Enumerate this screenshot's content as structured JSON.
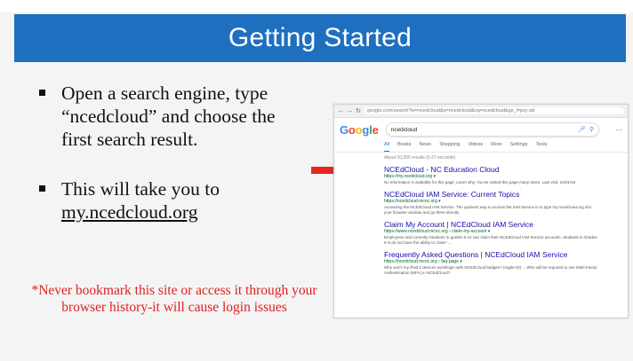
{
  "slide": {
    "title": "Getting Started",
    "bullets": [
      {
        "text": "Open a search engine, type “ncedcloud” and choose the first search result."
      },
      {
        "prefix": "This will take you to ",
        "link": "my.ncedcloud.org"
      }
    ],
    "warning": "*Never bookmark this site or access it through your browser history-it will cause login issues"
  },
  "colors": {
    "title_bar": "#1f6fc0",
    "warning": "#e02020",
    "arrow": "#e8251d"
  },
  "screenshot": {
    "url": "google.com/search?ei=ncedcloud&q=ncedcloud&oq=ncedcloud&gs_l=psy-ab",
    "logo": "Google",
    "query": "ncedcloud",
    "tabs": [
      "All",
      "Books",
      "News",
      "Shopping",
      "Videos",
      "More",
      "Settings",
      "Tools"
    ],
    "stats": "About 10,300 results (0.37 seconds)",
    "results": [
      {
        "title": "NCEdCloud - NC Education Cloud",
        "url": "https://my.ncedcloud.org ▾",
        "desc": "No information is available for this page. Learn why. You've visited this page many times. Last visit: 10/31/19"
      },
      {
        "title": "NCEdCloud IAM Service: Current Topics",
        "url": "https://ncedcloud.mcnc.org ▾",
        "desc": "Accessing the NCEdCloud IAM Service. The quickest way to access the IAM Service is to type my.ncedcloud.org into your browser window and go there directly."
      },
      {
        "title": "Claim My Account | NCEdCloud IAM Service",
        "url": "https://www.ncedcloud.mcnc.org › claim-my-account ▾",
        "desc": "Employees and currently Students in grades 6-12 can claim their NCEdCloud IAM Service accounts. Students in Grades K-5 do not have the ability to 'claim' ..."
      },
      {
        "title": "Frequently Asked Questions | NCEdCloud IAM Service",
        "url": "https://ncedcloud.mcnc.org › faq-page ▾",
        "desc": "Why won't my iPad 2 devices work/login with NCEdCloud badges? (Apple ID) ... Who will be required to use Multi-Factor Authentication (MFA) in NCEdCloud?"
      }
    ]
  }
}
